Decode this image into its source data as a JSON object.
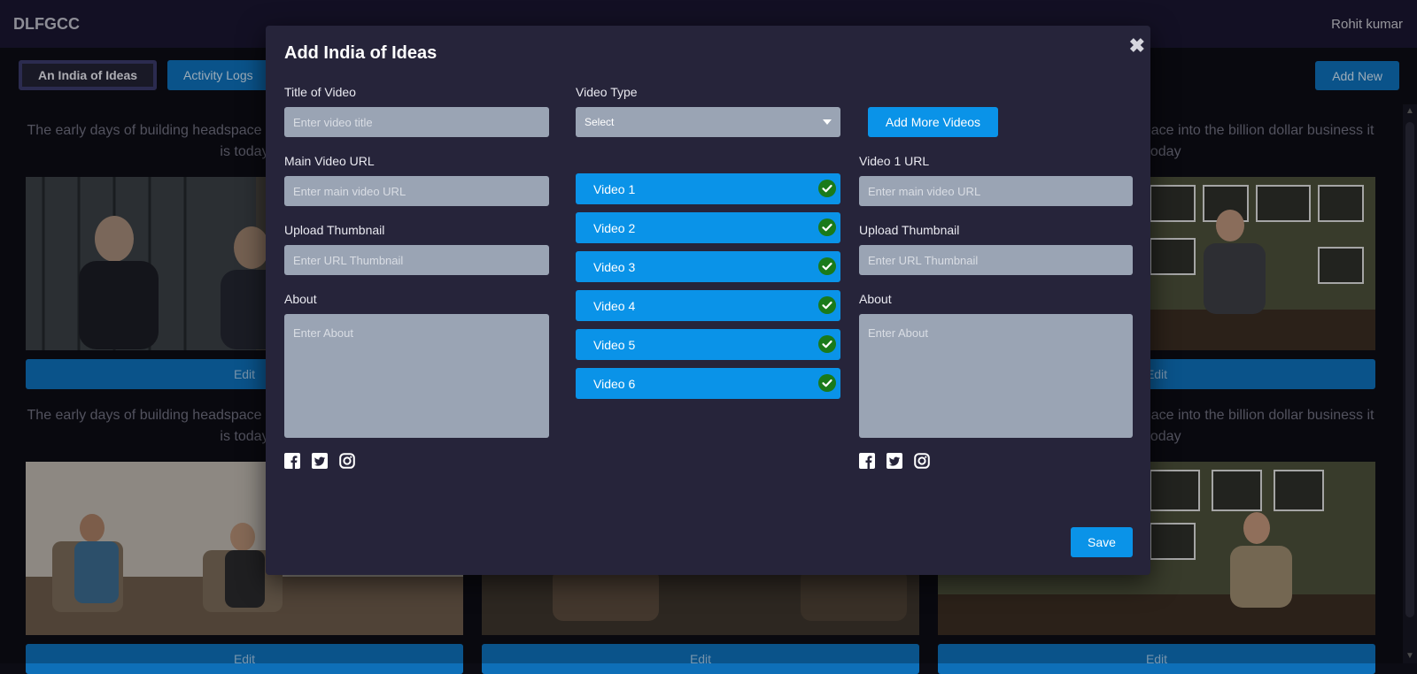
{
  "app": {
    "brand": "DLFGCC",
    "user": "Rohit kumar"
  },
  "tabs": [
    {
      "label": "An India of Ideas",
      "active": true
    },
    {
      "label": "Activity Logs",
      "active": false
    }
  ],
  "add_new_label": "Add New",
  "cards": [
    {
      "desc": "The early days of building headspace into the billion dollar business it is today",
      "edit": "Edit"
    },
    {
      "desc": "The early days of building headspace into the billion dollar business it is today",
      "edit": "Edit"
    },
    {
      "desc": "The early days of building headspace into the billion dollar business it is today",
      "edit": "Edit"
    },
    {
      "desc": "The early days of building headspace into the billion dollar business it is today",
      "edit": "Edit"
    }
  ],
  "modal": {
    "title": "Add India of Ideas",
    "close_icon": "close-icon",
    "left": {
      "title_label": "Title of Video",
      "title_placeholder": "Enter video title",
      "main_url_label": "Main Video URL",
      "main_url_placeholder": "Enter main video URL",
      "thumb_label": "Upload Thumbnail",
      "thumb_placeholder": "Enter URL Thumbnail",
      "about_label": "About",
      "about_placeholder": "Enter About"
    },
    "middle": {
      "type_label": "Video Type",
      "type_value": "Select",
      "add_more_label": "Add More Videos",
      "videos": [
        "Video 1",
        "Video 2",
        "Video 3",
        "Video 4",
        "Video 5",
        "Video 6"
      ]
    },
    "right": {
      "url_label": "Video 1 URL",
      "url_placeholder": "Enter main video URL",
      "thumb_label": "Upload Thumbnail",
      "thumb_placeholder": "Enter URL Thumbnail",
      "about_label": "About",
      "about_placeholder": "Enter About"
    },
    "social_icons": [
      "facebook-icon",
      "twitter-icon",
      "instagram-icon"
    ],
    "save_label": "Save"
  },
  "colors": {
    "accent": "#0a93e8",
    "modal_bg": "#26243a",
    "field_bg": "#9aa4b4",
    "check": "#1a7a1a"
  }
}
